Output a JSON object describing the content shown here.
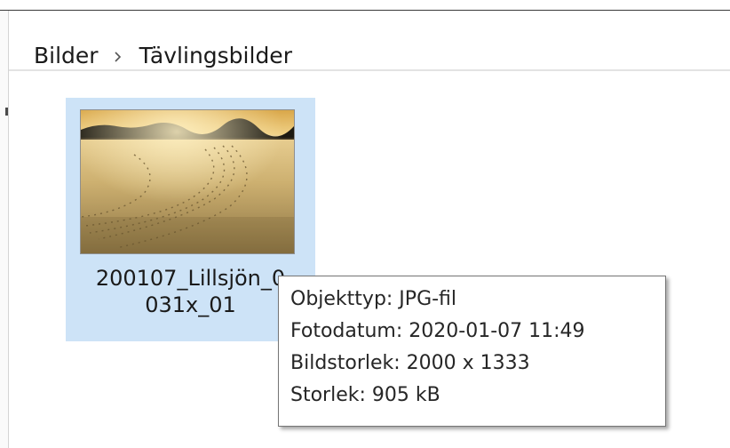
{
  "breadcrumb": {
    "items": [
      "Bilder",
      "Tävlingsbilder"
    ],
    "separator_icon": "chevron-right-icon"
  },
  "file": {
    "name_line1": "200107_Lillsjön_0",
    "name_line2": "031x_01"
  },
  "tooltip": {
    "type": "Objekttyp: JPG-fil",
    "date": "Fotodatum: 2020-01-07 11:49",
    "dimensions": "Bildstorlek: 2000 x 1333",
    "size": "Storlek: 905 kB"
  },
  "colors": {
    "selection": "#cde3f7",
    "tooltip_border": "#767676",
    "text": "#1a1a1a"
  }
}
